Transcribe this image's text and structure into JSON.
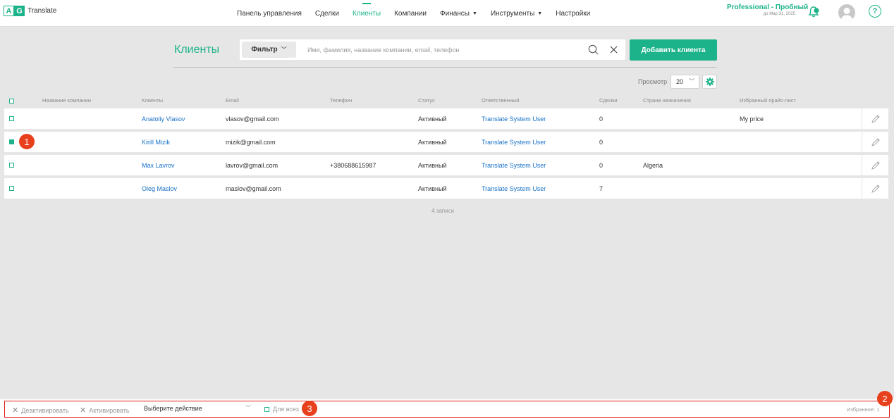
{
  "app": {
    "logo_left": "A",
    "logo_right": "G",
    "name": "Translate"
  },
  "nav": [
    {
      "label": "Панель управления",
      "active": false,
      "dropdown": false
    },
    {
      "label": "Сделки",
      "active": false,
      "dropdown": false
    },
    {
      "label": "Клиенты",
      "active": true,
      "dropdown": false
    },
    {
      "label": "Компании",
      "active": false,
      "dropdown": false
    },
    {
      "label": "Финансы",
      "active": false,
      "dropdown": true
    },
    {
      "label": "Инструменты",
      "active": false,
      "dropdown": true
    },
    {
      "label": "Настройки",
      "active": false,
      "dropdown": false
    }
  ],
  "plan": {
    "name": "Professional - Пробный",
    "expires": "до Мар 31, 2025"
  },
  "help_label": "?",
  "page": {
    "title": "Клиенты"
  },
  "search": {
    "filter_label": "Фильтр",
    "placeholder": "Имя, фамилия, название компании, email, телефон"
  },
  "add_button": "Добавить клиента",
  "view": {
    "label": "Просмотр",
    "value": "20"
  },
  "columns": {
    "company": "Название компании",
    "client": "Клиенты",
    "email": "Email",
    "phone": "Телефон",
    "status": "Статус",
    "responsible": "Ответственный",
    "deals": "Сделки",
    "country": "Страна назначения",
    "price": "Избранный прайс-лист"
  },
  "rows": [
    {
      "checked": false,
      "company": "",
      "client": "Anatoliy Vlasov",
      "email": "vlasov@gmail.com",
      "phone": "",
      "status": "Активный",
      "responsible": "Translate System User",
      "deals": "0",
      "country": "",
      "price": "My price"
    },
    {
      "checked": true,
      "company": "",
      "client": "Kirill Mizik",
      "email": "mizik@gmail.com",
      "phone": "",
      "status": "Активный",
      "responsible": "Translate System User",
      "deals": "0",
      "country": "",
      "price": ""
    },
    {
      "checked": false,
      "company": "",
      "client": "Max Lavrov",
      "email": "lavrov@gmail.com",
      "phone": "+380688615987",
      "status": "Активный",
      "responsible": "Translate System User",
      "deals": "0",
      "country": "Algeria",
      "price": ""
    },
    {
      "checked": false,
      "company": "",
      "client": "Oleg Maslov",
      "email": "maslov@gmail.com",
      "phone": "",
      "status": "Активный",
      "responsible": "Translate System User",
      "deals": "7",
      "country": "",
      "price": ""
    }
  ],
  "records_count": "4 записи",
  "bottom": {
    "deactivate": "Деактивировать",
    "activate": "Активировать",
    "action_placeholder": "Выберите действие",
    "for_all": "Для всех",
    "favorites": "Избранное: 1"
  },
  "callouts": [
    "1",
    "2",
    "3"
  ],
  "colors": {
    "accent": "#1db38a",
    "link": "#1a73c8",
    "callout": "#e8401c",
    "frame": "#e01b1b"
  }
}
